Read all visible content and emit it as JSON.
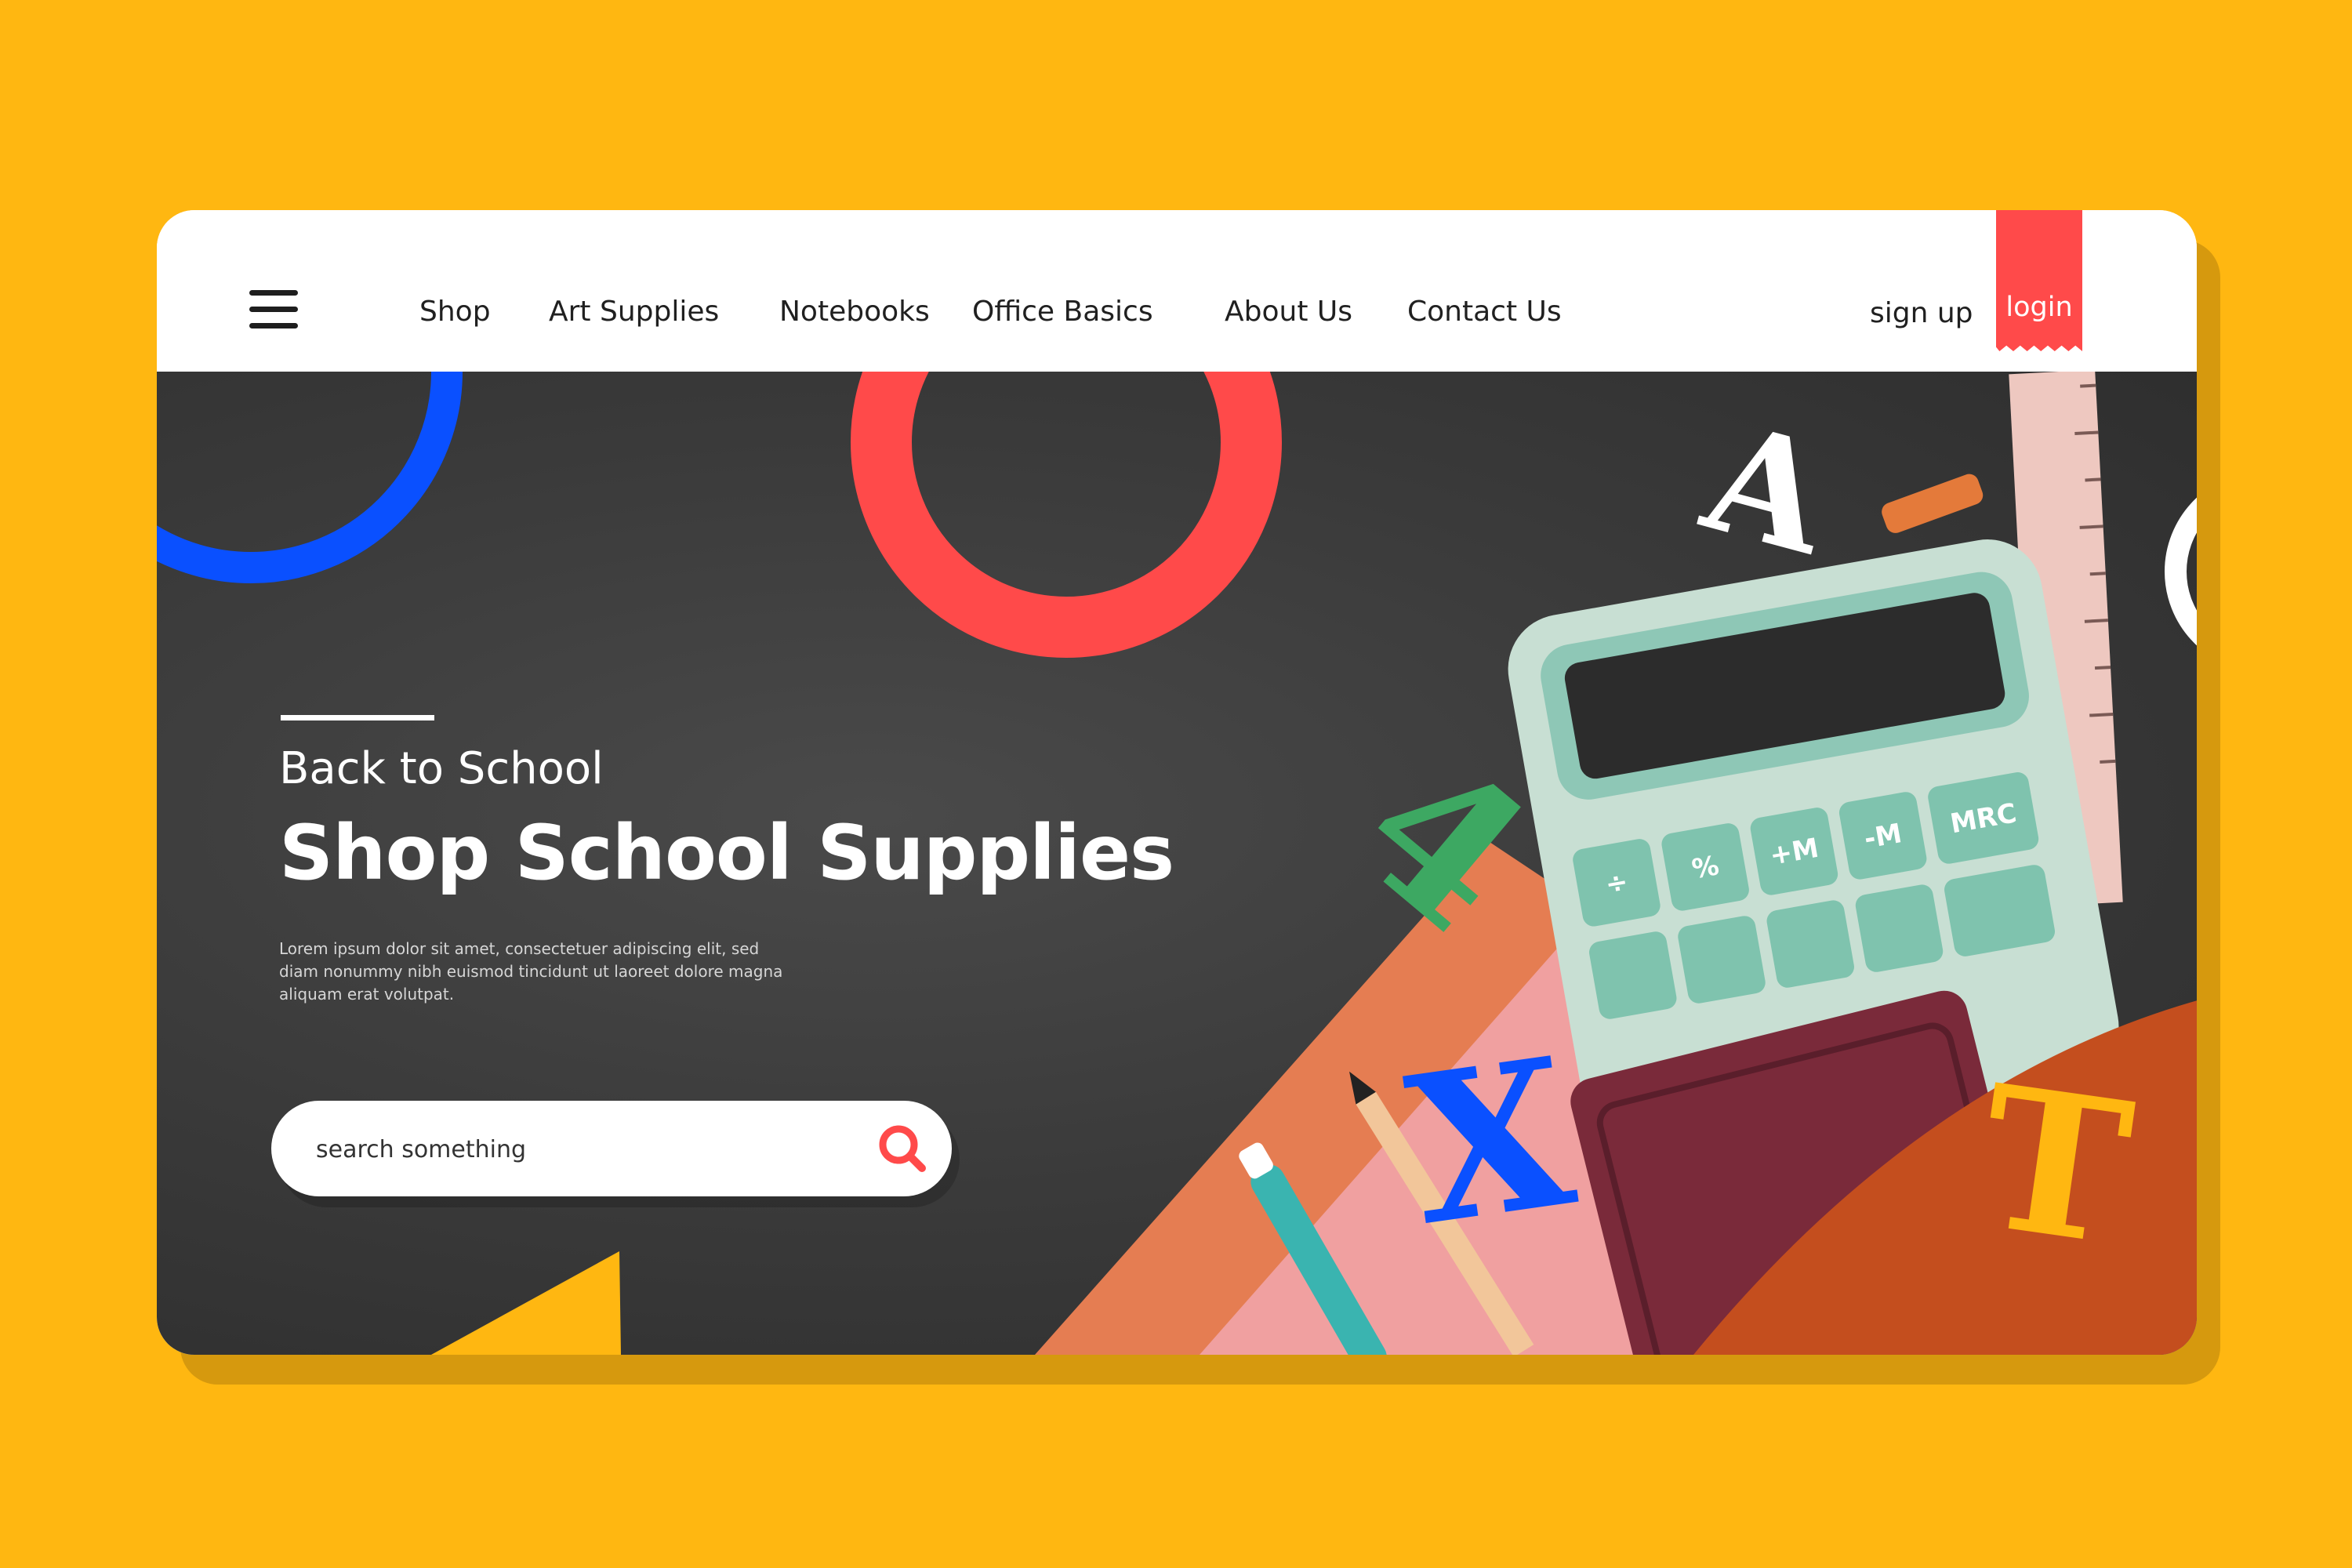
{
  "nav": {
    "menu_icon": "hamburger-menu-icon",
    "links": [
      "Shop",
      "Art Supplies",
      "Notebooks",
      "Office Basics",
      "About Us",
      "Contact Us"
    ],
    "signup": "sign up",
    "login": "login"
  },
  "hero": {
    "eyebrow": "Back to School",
    "title": "Shop School Supplies",
    "body": "Lorem ipsum dolor sit amet, consectetuer adipiscing elit, sed diam nonummy nibh euismod tincidunt ut laoreet dolore magna aliquam erat volutpat.",
    "decor_letters": [
      "A",
      "4",
      "X",
      "T"
    ],
    "calculator_keys": [
      "÷",
      "%",
      "+M",
      "-M",
      "MRC"
    ]
  },
  "search": {
    "placeholder": "search something",
    "icon": "search-icon"
  },
  "colors": {
    "background": "#FFB711",
    "accent_red": "#FF4A4A",
    "accent_blue": "#0A50FF",
    "accent_green": "#3DA862",
    "accent_yellow": "#FFB711",
    "board": "#3a3a3a"
  }
}
